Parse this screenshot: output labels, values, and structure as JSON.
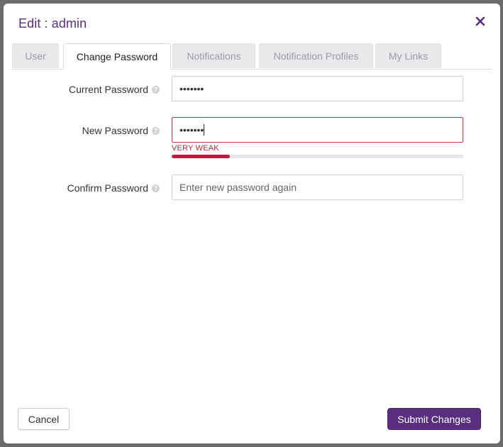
{
  "dialog": {
    "title": "Edit : admin",
    "close_icon": "close-x-icon"
  },
  "tabs": [
    {
      "label": "User",
      "active": false
    },
    {
      "label": "Change Password",
      "active": true
    },
    {
      "label": "Notifications",
      "active": false
    },
    {
      "label": "Notification Profiles",
      "active": false
    },
    {
      "label": "My Links",
      "active": false
    }
  ],
  "form": {
    "current_password": {
      "label": "Current Password",
      "value": "•••••••",
      "help_icon": "question-circle-icon"
    },
    "new_password": {
      "label": "New Password",
      "value": "•••••••",
      "help_icon": "question-circle-icon",
      "strength_label": "VERY WEAK",
      "strength_fraction": 0.2
    },
    "confirm_password": {
      "label": "Confirm Password",
      "value": "",
      "placeholder": "Enter new password again",
      "help_icon": "question-circle-icon"
    }
  },
  "buttons": {
    "cancel": "Cancel",
    "submit": "Submit Changes"
  },
  "colors": {
    "accent": "#5a2d7f",
    "title": "#5b2d82",
    "strength_weak": "#c9143c"
  }
}
